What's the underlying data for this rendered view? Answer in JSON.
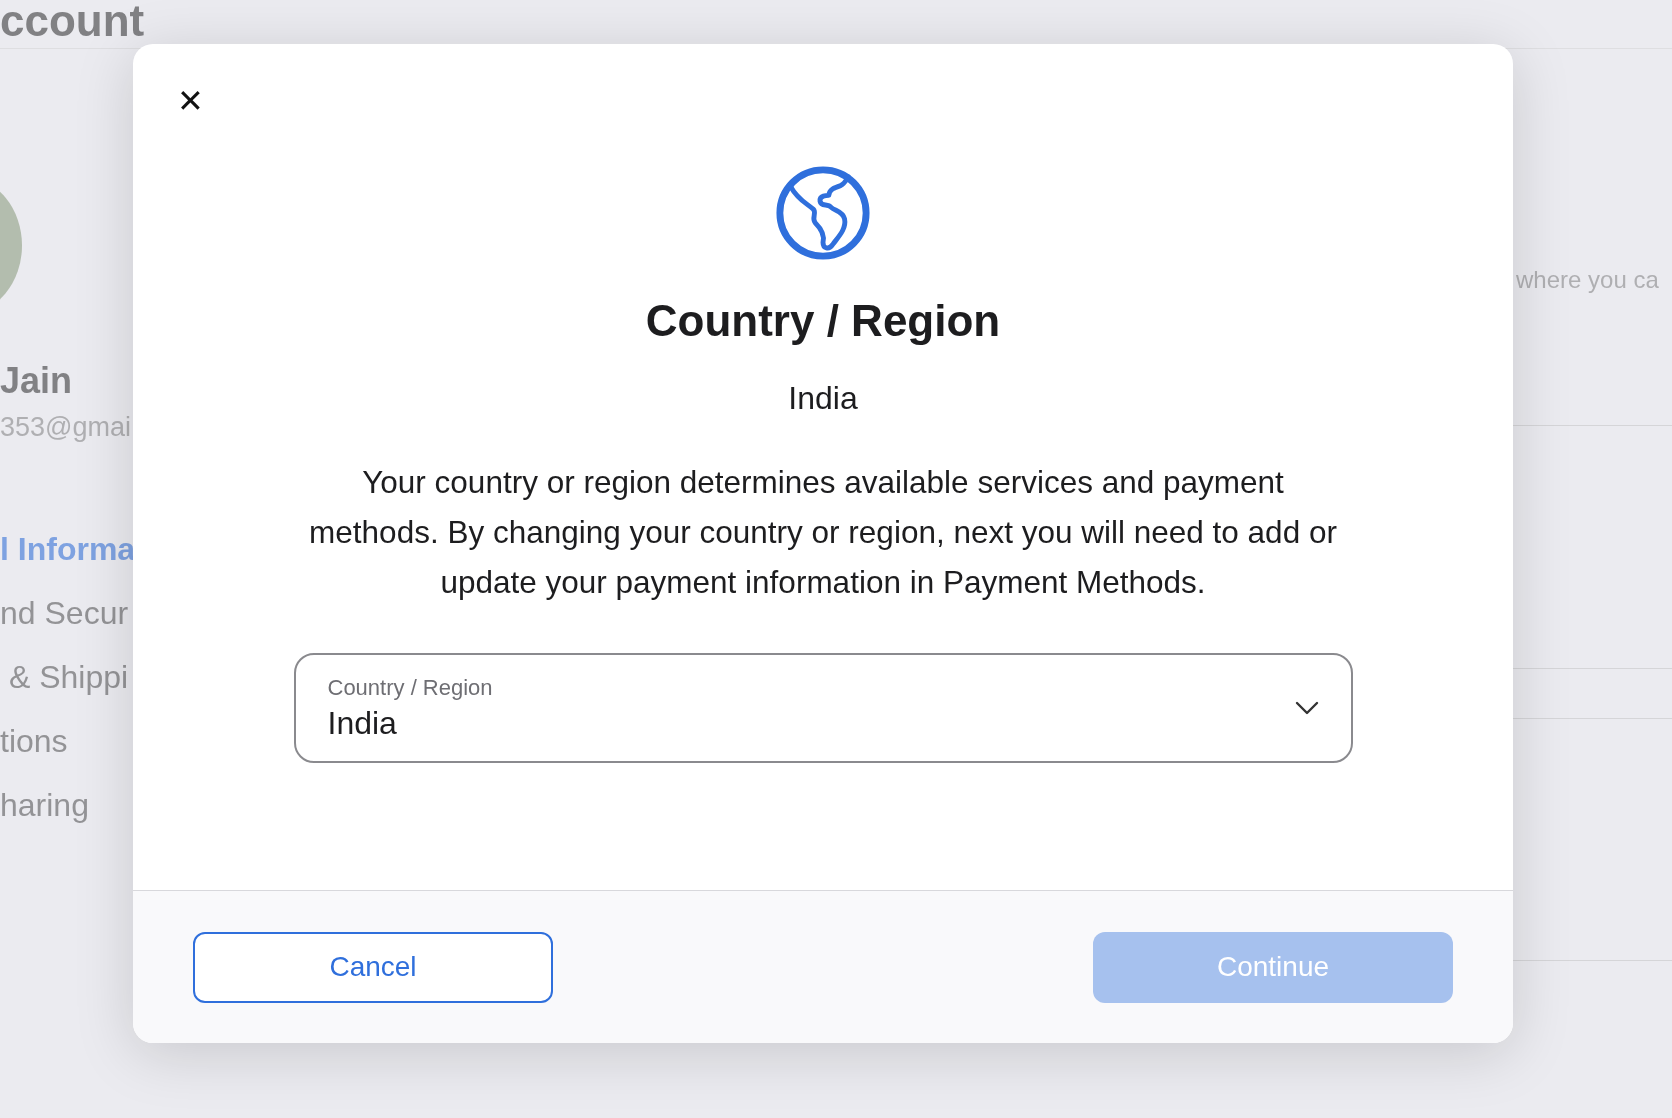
{
  "background": {
    "page_title": "ccount",
    "user_name": "Jain",
    "user_email": "353@gmai",
    "nav_items": [
      {
        "label": "l Informa",
        "selected": true
      },
      {
        "label": "nd Secur",
        "selected": false
      },
      {
        "label": " & Shippi",
        "selected": false
      },
      {
        "label": "tions",
        "selected": false
      },
      {
        "label": "haring",
        "selected": false
      }
    ],
    "side_text": "where you ca"
  },
  "dialog": {
    "close_label": "✕",
    "title": "Country / Region",
    "current_value": "India",
    "description": "Your country or region determines available services and payment methods. By changing your country or region, next you will need to add or update your payment information in Payment Methods.",
    "select": {
      "label": "Country / Region",
      "value": "India"
    },
    "buttons": [
      {
        "label": "Cancel",
        "kind": "secondary",
        "disabled": false
      },
      {
        "label": "Continue",
        "kind": "primary",
        "disabled": true
      }
    ]
  }
}
